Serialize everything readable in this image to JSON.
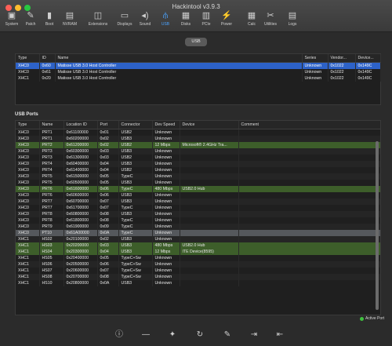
{
  "window": {
    "title": "Hackintool v3.9.3"
  },
  "toolbar": [
    {
      "label": "System",
      "icon": "system-icon",
      "glyph": "▣"
    },
    {
      "label": "Patch",
      "icon": "patch-icon",
      "glyph": "✎"
    },
    {
      "label": "Boot",
      "icon": "boot-icon",
      "glyph": "▮"
    },
    {
      "label": "NVRAM",
      "icon": "nvram-icon",
      "glyph": "▤"
    },
    {
      "label": "Extensions",
      "icon": "extensions-icon",
      "glyph": "◫"
    },
    {
      "label": "Displays",
      "icon": "displays-icon",
      "glyph": "▭"
    },
    {
      "label": "Sound",
      "icon": "sound-icon",
      "glyph": "◂)"
    },
    {
      "label": "USB",
      "icon": "usb-icon",
      "glyph": "⫛",
      "active": true
    },
    {
      "label": "Disks",
      "icon": "disks-icon",
      "glyph": "▦"
    },
    {
      "label": "PCIe",
      "icon": "pcie-icon",
      "glyph": "▥"
    },
    {
      "label": "Power",
      "icon": "power-icon",
      "glyph": "⚡"
    },
    {
      "label": "Calc",
      "icon": "calc-icon",
      "glyph": "▦"
    },
    {
      "label": "Utilities",
      "icon": "utilities-icon",
      "glyph": "✂"
    },
    {
      "label": "Logs",
      "icon": "logs-icon",
      "glyph": "▤"
    }
  ],
  "segment": {
    "label": "USB"
  },
  "controllers": {
    "columns": [
      "Type",
      "ID",
      "Name",
      "Series",
      "Vendor...",
      "Device..."
    ],
    "rows": [
      {
        "type": "XHC0",
        "id": "0x60",
        "name": "Matisse USB 3.0 Host Controller",
        "series": "Unknown",
        "vendor": "0x1022",
        "device": "0x149C",
        "selected": true
      },
      {
        "type": "XHC0",
        "id": "0x61",
        "name": "Matisse USB 3.0 Host Controller",
        "series": "Unknown",
        "vendor": "0x1022",
        "device": "0x149C"
      },
      {
        "type": "XHC1",
        "id": "0x20",
        "name": "Matisse USB 3.0 Host Controller",
        "series": "Unknown",
        "vendor": "0x1022",
        "device": "0x149C"
      }
    ]
  },
  "ports_label": "USB Ports",
  "ports": {
    "columns": [
      "Type",
      "Name",
      "Location ID",
      "Port",
      "Connector",
      "Dev Speed",
      "Device",
      "Comment"
    ],
    "rows": [
      {
        "type": "XHC0",
        "name": "PRT1",
        "loc": "0x61100000",
        "port": "0x01",
        "conn": "USB2",
        "speed": "Unknown",
        "device": "",
        "comment": ""
      },
      {
        "type": "XHC0",
        "name": "PRT1",
        "loc": "0x60200000",
        "port": "0x02",
        "conn": "USB3",
        "speed": "Unknown",
        "device": "",
        "comment": ""
      },
      {
        "type": "XHC0",
        "name": "PRT2",
        "loc": "0x61200000",
        "port": "0x02",
        "conn": "USB2",
        "speed": "12 Mbps",
        "device": "Microsoft® 2.4GHz Tra...",
        "comment": "",
        "hl": "green"
      },
      {
        "type": "XHC0",
        "name": "PRT3",
        "loc": "0x60300000",
        "port": "0x03",
        "conn": "USB3",
        "speed": "Unknown",
        "device": "",
        "comment": ""
      },
      {
        "type": "XHC0",
        "name": "PRT3",
        "loc": "0x61300000",
        "port": "0x03",
        "conn": "USB2",
        "speed": "Unknown",
        "device": "",
        "comment": ""
      },
      {
        "type": "XHC0",
        "name": "PRT4",
        "loc": "0x60400000",
        "port": "0x04",
        "conn": "USB3",
        "speed": "Unknown",
        "device": "",
        "comment": ""
      },
      {
        "type": "XHC0",
        "name": "PRT4",
        "loc": "0x61400000",
        "port": "0x04",
        "conn": "USB2",
        "speed": "Unknown",
        "device": "",
        "comment": ""
      },
      {
        "type": "XHC0",
        "name": "PRT5",
        "loc": "0x61500000",
        "port": "0x05",
        "conn": "TypeC",
        "speed": "Unknown",
        "device": "",
        "comment": ""
      },
      {
        "type": "XHC0",
        "name": "PRT5",
        "loc": "0x60500000",
        "port": "0x05",
        "conn": "USB3",
        "speed": "Unknown",
        "device": "",
        "comment": ""
      },
      {
        "type": "XHC0",
        "name": "PRT6",
        "loc": "0x61600000",
        "port": "0x06",
        "conn": "TypeC",
        "speed": "480 Mbps",
        "device": "USB2.0 Hub",
        "comment": "",
        "hl": "green"
      },
      {
        "type": "XHC0",
        "name": "PRT6",
        "loc": "0x60600000",
        "port": "0x06",
        "conn": "USB3",
        "speed": "Unknown",
        "device": "",
        "comment": ""
      },
      {
        "type": "XHC0",
        "name": "PRT7",
        "loc": "0x60700000",
        "port": "0x07",
        "conn": "USB3",
        "speed": "Unknown",
        "device": "",
        "comment": ""
      },
      {
        "type": "XHC0",
        "name": "PRT7",
        "loc": "0x61700000",
        "port": "0x07",
        "conn": "TypeC",
        "speed": "Unknown",
        "device": "",
        "comment": ""
      },
      {
        "type": "XHC0",
        "name": "PRT8",
        "loc": "0x60800000",
        "port": "0x08",
        "conn": "USB3",
        "speed": "Unknown",
        "device": "",
        "comment": ""
      },
      {
        "type": "XHC0",
        "name": "PRT8",
        "loc": "0x61800000",
        "port": "0x08",
        "conn": "TypeC",
        "speed": "Unknown",
        "device": "",
        "comment": ""
      },
      {
        "type": "XHC0",
        "name": "PRT9",
        "loc": "0x61900000",
        "port": "0x09",
        "conn": "TypeC",
        "speed": "Unknown",
        "device": "",
        "comment": ""
      },
      {
        "type": "XHC0",
        "name": "PT10",
        "loc": "0x61A00000",
        "port": "0x0A",
        "conn": "TypeC",
        "speed": "Unknown",
        "device": "",
        "comment": "",
        "hl": "gray"
      },
      {
        "type": "XHC1",
        "name": "HS02",
        "loc": "0x20100000",
        "port": "0x02",
        "conn": "USB3",
        "speed": "Unknown",
        "device": "",
        "comment": ""
      },
      {
        "type": "XHC1",
        "name": "HS03",
        "loc": "0x20200000",
        "port": "0x03",
        "conn": "USB3",
        "speed": "480 Mbps",
        "device": "USB2.0 Hub",
        "comment": "",
        "hl": "green"
      },
      {
        "type": "XHC1",
        "name": "HS04",
        "loc": "0x20300000",
        "port": "0x04",
        "conn": "USB3",
        "speed": "12 Mbps",
        "device": "ITE Device(8595)",
        "comment": "",
        "hl": "green"
      },
      {
        "type": "XHC1",
        "name": "HS05",
        "loc": "0x20400000",
        "port": "0x05",
        "conn": "TypeC+Sw",
        "speed": "Unknown",
        "device": "",
        "comment": ""
      },
      {
        "type": "XHC1",
        "name": "HS06",
        "loc": "0x20500000",
        "port": "0x06",
        "conn": "TypeC+Sw",
        "speed": "Unknown",
        "device": "",
        "comment": ""
      },
      {
        "type": "XHC1",
        "name": "HS07",
        "loc": "0x20600000",
        "port": "0x07",
        "conn": "TypeC+Sw",
        "speed": "Unknown",
        "device": "",
        "comment": ""
      },
      {
        "type": "XHC1",
        "name": "HS08",
        "loc": "0x20700000",
        "port": "0x08",
        "conn": "TypeC+Sw",
        "speed": "Unknown",
        "device": "",
        "comment": ""
      },
      {
        "type": "XHC1",
        "name": "HS10",
        "loc": "0x20800000",
        "port": "0x0A",
        "conn": "USB3",
        "speed": "Unknown",
        "device": "",
        "comment": ""
      }
    ]
  },
  "legend": {
    "label": "Active Port",
    "color": "#3fbf3f"
  },
  "bottom_icons": [
    {
      "icon": "info-icon",
      "glyph": "ⓘ"
    },
    {
      "icon": "remove-icon",
      "glyph": "—"
    },
    {
      "icon": "clean-icon",
      "glyph": "✦"
    },
    {
      "icon": "refresh-icon",
      "glyph": "↻"
    },
    {
      "icon": "edit-icon",
      "glyph": "✎"
    },
    {
      "icon": "import-icon",
      "glyph": "⇥"
    },
    {
      "icon": "export-icon",
      "glyph": "⇤"
    }
  ]
}
